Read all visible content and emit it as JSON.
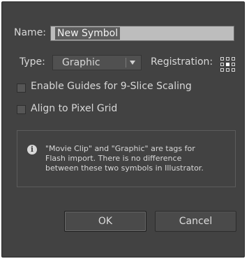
{
  "name": {
    "label": "Name:",
    "value": "New Symbol"
  },
  "type": {
    "label": "Type:",
    "selected": "Graphic"
  },
  "registration": {
    "label": "Registration:",
    "selected_point": "center"
  },
  "options": {
    "nine_slice": {
      "label": "Enable Guides for 9-Slice Scaling",
      "checked": false
    },
    "pixel_grid": {
      "label": "Align to Pixel Grid",
      "checked": false
    }
  },
  "info": {
    "icon": "info-icon",
    "lines": [
      "\"Movie Clip\" and \"Graphic\" are tags for",
      "Flash import. There is no difference",
      "between these two symbols in Illustrator."
    ]
  },
  "buttons": {
    "ok": "OK",
    "cancel": "Cancel"
  },
  "colors": {
    "dialog_bg": "#424242",
    "text": "#d8d8d8",
    "input_bg": "#bdbdbd"
  }
}
